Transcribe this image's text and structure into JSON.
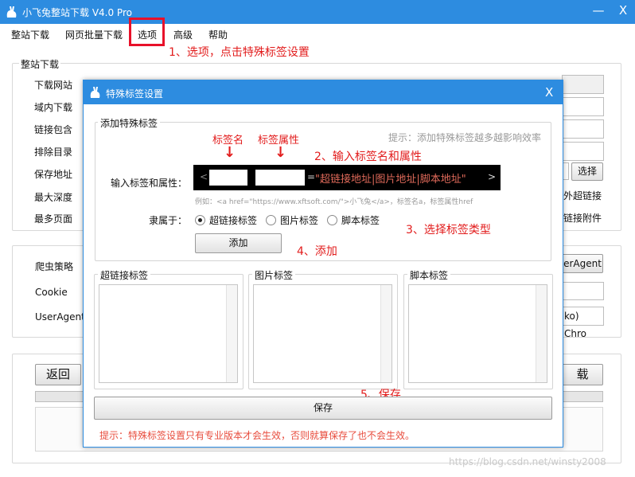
{
  "window": {
    "title": "小飞兔整站下载 V4.0 Pro",
    "minimize": "—",
    "close": "X"
  },
  "menu": {
    "items": [
      "整站下载",
      "网页批量下载",
      "选项",
      "高级",
      "帮助"
    ]
  },
  "annotations": {
    "step1": "1、选项，点击特殊标签设置",
    "step2": "2、输入标签名和属性",
    "step3": "3、选择标签类型",
    "step4": "4、添加",
    "step5": "5、保存",
    "tag_name": "标签名",
    "tag_attr": "标签属性",
    "arrow": "↓"
  },
  "main": {
    "group_title": "整站下载",
    "labels": {
      "site": "下载网站",
      "domain": "域内下载",
      "link_contains": "链接包含",
      "exclude": "排除目录",
      "save_path": "保存地址",
      "max_depth": "最大深度",
      "max_pages": "最多页面"
    },
    "browse_button": "选择",
    "external_links": "外超链接",
    "link_attachments": "链接附件",
    "crawler_label": "爬虫策略",
    "cookie_label": "Cookie",
    "useragent_label": "UserAgent",
    "useragent_button": "erAgent",
    "useragent_value": "ko) Chro",
    "back_button": "返回",
    "download_button": "载"
  },
  "dialog": {
    "title": "特殊标签设置",
    "close": "X",
    "add_group": "添加特殊标签",
    "hint": "提示：添加特殊标签越多越影响效率",
    "input_label": "输入标签和属性：",
    "editor": {
      "open": "<",
      "equals": "=",
      "value": "\"超链接地址|图片地址|脚本地址\"",
      "close": ">"
    },
    "example": "例如：<a href=\"https://www.xftsoft.com/\">小飞兔</a>，标签名a，标签属性href",
    "belongs_label": "隶属于：",
    "radios": [
      {
        "label": "超链接标签",
        "selected": true
      },
      {
        "label": "图片标签",
        "selected": false
      },
      {
        "label": "脚本标签",
        "selected": false
      }
    ],
    "add_button": "添加",
    "lists": [
      "超链接标签",
      "图片标签",
      "脚本标签"
    ],
    "save_button": "保存",
    "footer_hint": "提示：特殊标签设置只有专业版本才会生效，否则就算保存了也不会生效。"
  },
  "watermark": "https://blog.csdn.net/winsty2008",
  "colors": {
    "titlebar": "#2d8ce0",
    "annotation": "#e21c1c",
    "highlight": "#e8112a"
  }
}
